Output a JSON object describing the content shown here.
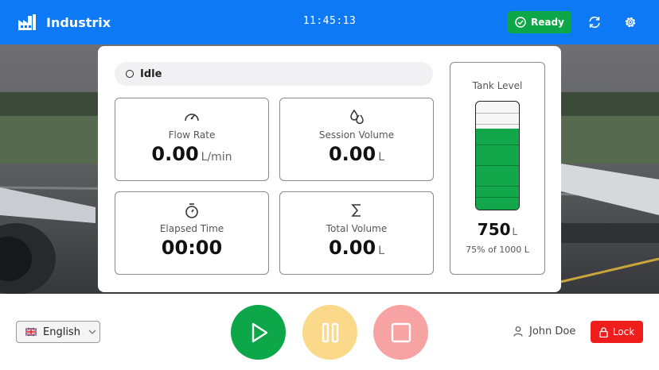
{
  "header": {
    "brand_icon": "factory-icon",
    "brand_name": "Industrix",
    "time": "11:45:13",
    "status_label": "Ready",
    "status_icon": "check-circle-icon",
    "refresh_icon": "refresh-icon",
    "settings_icon": "gear-icon",
    "color": "#0e79f4"
  },
  "panel": {
    "state_label": "Idle",
    "cards": {
      "flow_rate": {
        "label": "Flow Rate",
        "value": "0.00",
        "unit": "L/min",
        "icon": "gauge-icon"
      },
      "session_volume": {
        "label": "Session Volume",
        "value": "0.00",
        "unit": "L",
        "icon": "droplets-icon"
      },
      "elapsed_time": {
        "label": "Elapsed Time",
        "value": "00:00",
        "icon": "stopwatch-icon"
      },
      "total_volume": {
        "label": "Total Volume",
        "value": "0.00",
        "unit": "L",
        "icon": "sigma-icon"
      }
    },
    "tank": {
      "title": "Tank Level",
      "value": "750",
      "unit": "L",
      "percent_text": "75% of 1000 L",
      "fill_fraction": 0.75,
      "fill_color": "#11a74a"
    }
  },
  "footer": {
    "language": "English",
    "language_flag": "uk-flag-icon",
    "controls": {
      "play": {
        "icon": "play-icon",
        "color": "#0da74a"
      },
      "pause": {
        "icon": "pause-icon",
        "color": "#fbd98b"
      },
      "stop": {
        "icon": "stop-icon",
        "color": "#f7a3a3"
      }
    },
    "user_name": "John Doe",
    "lock_label": "Lock"
  }
}
